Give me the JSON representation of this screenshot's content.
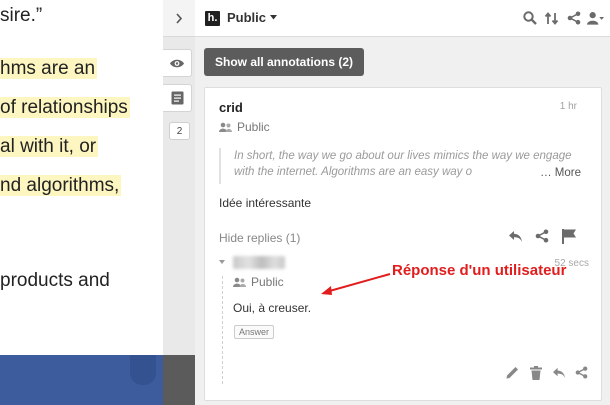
{
  "article": {
    "lines": [
      {
        "text": "sire.”",
        "highlighted": false
      },
      {
        "text": "hms are an",
        "highlighted": true
      },
      {
        "text": "of relationships",
        "highlighted": true
      },
      {
        "text": "al with it, or",
        "highlighted": true
      },
      {
        "text": "nd algorithms,",
        "highlighted": true
      },
      {
        "text": "products and",
        "highlighted": false
      }
    ],
    "highlight_color": "#fdf6c0",
    "footer_color": "#3d5c9e"
  },
  "gutter": {
    "collapse_icon": "chevron-right-icon",
    "buttons": [
      "eye-icon",
      "note-icon"
    ],
    "annotation_count": "2"
  },
  "topbar": {
    "logo": "h.",
    "group": "Public",
    "icons": [
      "search-icon",
      "sort-icon",
      "share-icon",
      "user-menu-icon"
    ]
  },
  "show_all_label": "Show all annotations (2)",
  "annotation": {
    "user": "crid",
    "time": "1 hr",
    "permission": "Public",
    "quote": "In short, the way we go about our lives mimics the way we engage with the internet. Algorithms are an easy way o",
    "quote_more": "… More",
    "body": "Idée intéressante",
    "hide_replies": "Hide replies (1)",
    "actions": [
      "reply-icon",
      "share-icon",
      "flag-icon"
    ]
  },
  "reply": {
    "time": "52 secs",
    "permission": "Public",
    "body": "Oui, à creuser.",
    "tag": "Answer",
    "actions": [
      "edit-icon",
      "delete-icon",
      "reply-icon",
      "share-icon"
    ]
  },
  "callout": {
    "text": "Réponse d'un utilisateur",
    "color": "#e11d1d"
  }
}
